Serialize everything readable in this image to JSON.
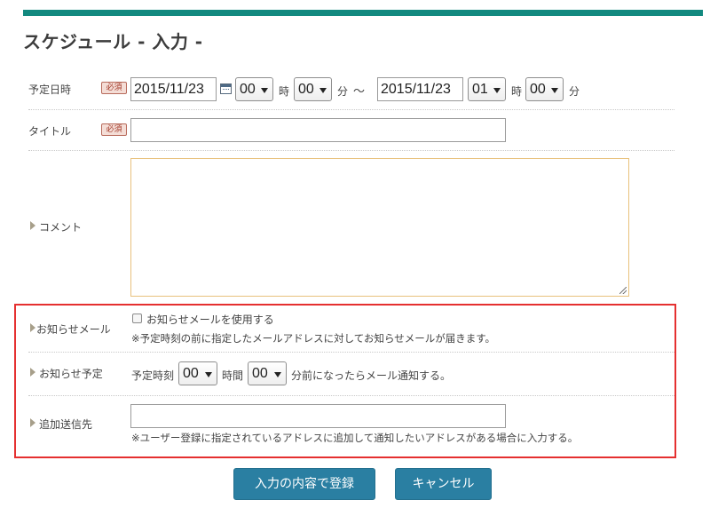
{
  "page": {
    "title": "スケジュール - 入力 -"
  },
  "required_badge": "必須",
  "colors": {
    "accent_bar": "#12897f",
    "button": "#2a7fa2",
    "highlight_box": "#e53030",
    "textarea_border": "#e8c17c"
  },
  "schedule_date": {
    "label": "予定日時",
    "start": {
      "date": "2015/11/23",
      "hour": "00",
      "minute": "00"
    },
    "separator": "～",
    "end": {
      "date": "2015/11/23",
      "hour": "01",
      "minute": "00"
    },
    "hour_unit": "時",
    "minute_unit": "分",
    "calendar_icon": "calendar-icon"
  },
  "title_field": {
    "label": "タイトル",
    "value": ""
  },
  "comment_field": {
    "label": "コメント",
    "value": ""
  },
  "notify_mail": {
    "label": "お知らせメール",
    "checkbox_label": "お知らせメールを使用する",
    "checked": false,
    "note": "※予定時刻の前に指定したメールアドレスに対してお知らせメールが届きます。"
  },
  "notify_schedule": {
    "label": "お知らせ予定",
    "prefix": "予定時刻",
    "hour": "00",
    "hour_unit": "時間",
    "minute": "00",
    "suffix": "分前になったらメール通知する。"
  },
  "extra_recipients": {
    "label": "追加送信先",
    "value": "",
    "note": "※ユーザー登録に指定されているアドレスに追加して通知したいアドレスがある場合に入力する。"
  },
  "buttons": {
    "submit": "入力の内容で登録",
    "cancel": "キャンセル"
  }
}
